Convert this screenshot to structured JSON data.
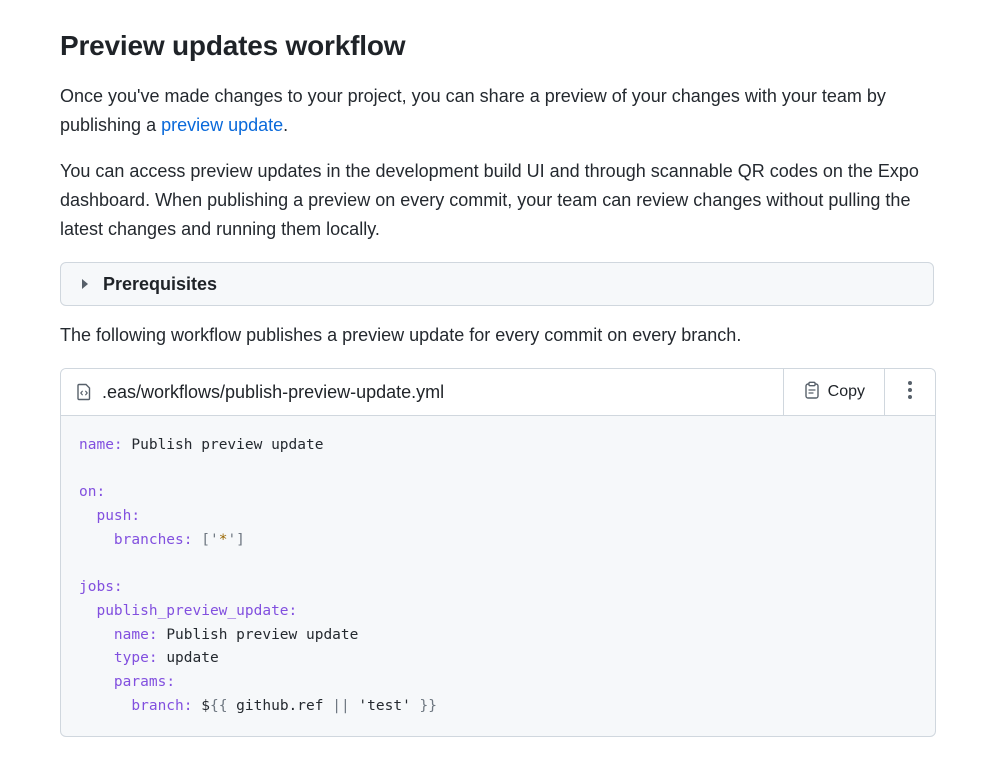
{
  "heading": "Preview updates workflow",
  "intro": {
    "before_link": "Once you've made changes to your project, you can share a preview of your changes with your team by publishing a ",
    "link_text": "preview update",
    "after_link": "."
  },
  "paragraph2": "You can access preview updates in the development build UI and through scannable QR codes on the Expo dashboard. When publishing a preview on every commit, your team can review changes without pulling the latest changes and running them locally.",
  "details": {
    "summary": "Prerequisites",
    "expanded": false
  },
  "paragraph3": "The following workflow publishes a preview update for every commit on every branch.",
  "code": {
    "file_name": ".eas/workflows/publish-preview-update.yml",
    "copy_label": "Copy",
    "icons": {
      "file": "code-file-icon",
      "copy": "clipboard-icon",
      "more": "more-vertical-icon"
    },
    "lines": [
      {
        "indent": "",
        "key": "name",
        "value": "Publish preview update"
      },
      {
        "indent": "",
        "key": "",
        "value": ""
      },
      {
        "indent": "",
        "key": "on",
        "value": ""
      },
      {
        "indent": "  ",
        "key": "push",
        "value": ""
      },
      {
        "indent": "    ",
        "key": "branches",
        "value": "['*']"
      },
      {
        "indent": "",
        "key": "",
        "value": ""
      },
      {
        "indent": "",
        "key": "jobs",
        "value": ""
      },
      {
        "indent": "  ",
        "key": "publish_preview_update",
        "value": ""
      },
      {
        "indent": "    ",
        "key": "name",
        "value": "Publish preview update"
      },
      {
        "indent": "    ",
        "key": "type",
        "value": "update"
      },
      {
        "indent": "    ",
        "key": "params",
        "value": ""
      },
      {
        "indent": "      ",
        "key": "branch",
        "value": "${{ github.ref || 'test' }}"
      }
    ]
  },
  "colors": {
    "link": "#0969da",
    "yaml_key": "#8250df",
    "string": "#9a6700",
    "border": "#d0d7de",
    "panel_bg": "#f6f8fa"
  }
}
